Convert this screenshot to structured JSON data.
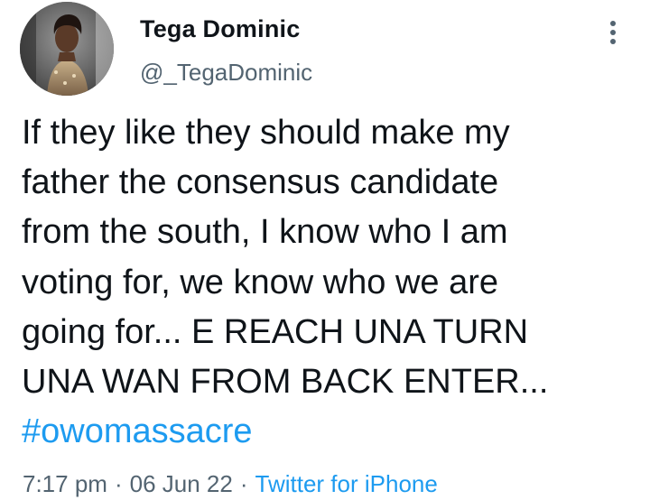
{
  "author": {
    "display_name": "Tega Dominic",
    "handle": "@_TegaDominic"
  },
  "tweet": {
    "lines": [
      "If they like they should make my",
      "father the consensus candidate",
      "from the south, I know who I am",
      "voting for, we know who we are",
      "going for... E REACH UNA TURN",
      "UNA WAN FROM BACK ENTER..."
    ],
    "hashtag": "#owomassacre"
  },
  "meta": {
    "time": "7:17 pm",
    "separator": "·",
    "date": "06 Jun 22",
    "source": "Twitter for iPhone"
  },
  "icons": {
    "more": "more-vertical-icon"
  },
  "colors": {
    "text": "#0f1419",
    "secondary": "#536471",
    "accent": "#1d9bf0"
  }
}
